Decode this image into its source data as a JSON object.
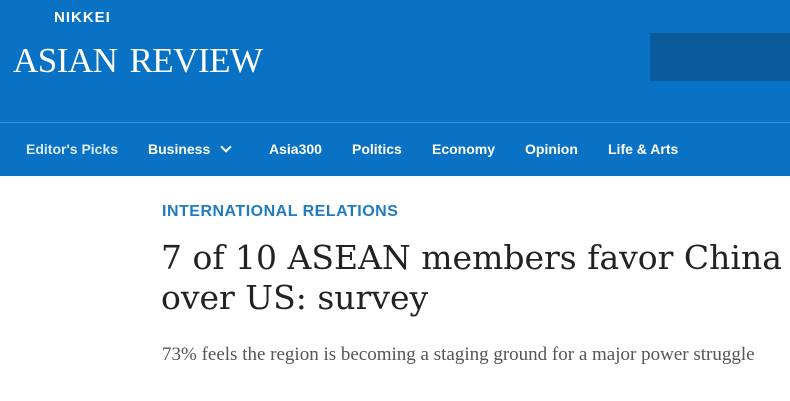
{
  "header": {
    "logo_top": "NIKKEI",
    "logo_main": "Asian Review"
  },
  "nav": {
    "items": [
      {
        "label": "Editor's Picks"
      },
      {
        "label": "Business",
        "has_dropdown": true,
        "dropdown_icon": "chevron-down-icon"
      },
      {
        "label": "Asia300"
      },
      {
        "label": "Politics"
      },
      {
        "label": "Economy"
      },
      {
        "label": "Opinion"
      },
      {
        "label": "Life & Arts"
      }
    ]
  },
  "article": {
    "kicker": "INTERNATIONAL RELATIONS",
    "headline": "7 of 10 ASEAN members favor China over US: survey",
    "subhead": "73% feels the region is becoming a staging ground for a major power struggle"
  },
  "colors": {
    "brand_blue": "#0a72c4",
    "kicker_blue": "#1f7bc3",
    "headline_text": "#222222",
    "subhead_text": "#555555"
  }
}
